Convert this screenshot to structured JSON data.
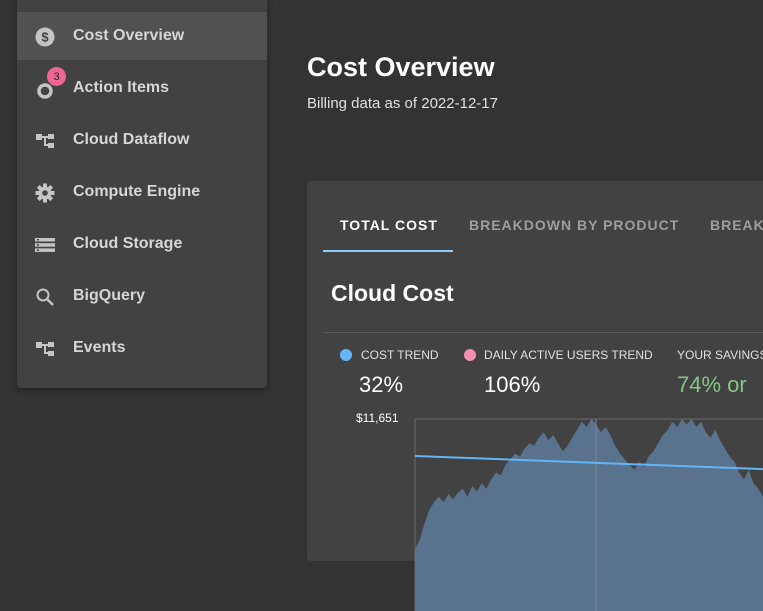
{
  "sidebar": {
    "items": [
      {
        "label": "Cost Overview",
        "icon": "dollar-circle-icon",
        "active": true
      },
      {
        "label": "Action Items",
        "icon": "action-items-icon",
        "badge": "3"
      },
      {
        "label": "Cloud Dataflow",
        "icon": "dataflow-icon"
      },
      {
        "label": "Compute Engine",
        "icon": "gear-icon"
      },
      {
        "label": "Cloud Storage",
        "icon": "storage-icon"
      },
      {
        "label": "BigQuery",
        "icon": "search-icon"
      },
      {
        "label": "Events",
        "icon": "events-icon"
      }
    ]
  },
  "header": {
    "title": "Cost Overview",
    "subtitle": "Billing data as of 2022-12-17"
  },
  "tabs": [
    {
      "label": "TOTAL COST",
      "active": true
    },
    {
      "label": "BREAKDOWN BY PRODUCT"
    },
    {
      "label": "BREAK"
    }
  ],
  "card": {
    "title": "Cloud Cost"
  },
  "metrics": [
    {
      "label": "COST TREND",
      "value": "32%",
      "color": "#64b5f6"
    },
    {
      "label": "DAILY ACTIVE USERS TREND",
      "value": "106%",
      "color": "#f48fb1"
    },
    {
      "label": "YOUR SAVINGS",
      "value": "74% or",
      "color": "#81c784"
    }
  ],
  "chart_data": {
    "type": "area",
    "y_top_label": "$11,651",
    "area_color": "#59738f",
    "trend_color": "#64b5f6",
    "values": [
      0.03,
      0.1,
      0.22,
      0.32,
      0.38,
      0.42,
      0.38,
      0.44,
      0.4,
      0.45,
      0.48,
      0.42,
      0.5,
      0.46,
      0.52,
      0.48,
      0.55,
      0.6,
      0.58,
      0.66,
      0.7,
      0.74,
      0.72,
      0.78,
      0.82,
      0.8,
      0.86,
      0.9,
      0.84,
      0.88,
      0.82,
      0.76,
      0.8,
      0.86,
      0.92,
      0.98,
      0.94,
      1.0,
      0.96,
      0.9,
      0.94,
      0.88,
      0.8,
      0.74,
      0.7,
      0.66,
      0.62,
      0.68,
      0.64,
      0.72,
      0.76,
      0.82,
      0.88,
      0.92,
      0.98,
      0.94,
      1.0,
      0.96,
      1.0,
      0.94,
      0.98,
      0.9,
      0.86,
      0.92,
      0.84,
      0.78,
      0.72,
      0.68,
      0.6,
      0.55,
      0.62,
      0.52,
      0.48,
      0.42
    ],
    "trend": [
      0.72,
      0.62
    ]
  }
}
